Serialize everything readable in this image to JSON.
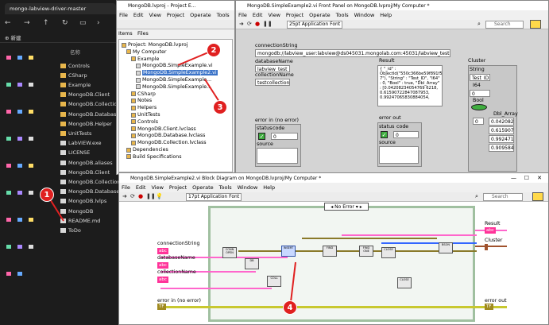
{
  "explorer": {
    "tab_title": "mongo-labview-driver-master",
    "new_label": "新建",
    "column_header": "名称",
    "items": [
      "Controls",
      "CSharp",
      "Example",
      "MongoDB.Client",
      "MongoDB.Collection",
      "MongoDB.Database",
      "MongoDB.Helper",
      "UnitTests",
      "LabVIEW.exe",
      "LICENSE",
      "MongoDB.aliases",
      "MongoDB.Client",
      "MongoDB.Collection",
      "MongoDB.Database",
      "MongoDB.lvlps",
      "MongoDB",
      "README.md",
      "ToDo"
    ]
  },
  "project": {
    "title": "MongoDB.lvproj - Project E...",
    "menu": [
      "File",
      "Edit",
      "View",
      "Project",
      "Operate",
      "Tools",
      "Window"
    ],
    "tabs": [
      "Items",
      "Files"
    ],
    "tree": [
      "Project: MongoDB.lvproj",
      "My Computer",
      "Example",
      "MongoDB.SimpleExample.vi",
      "MongoDB.SimpleExample2.vi",
      "MongoDB.SimpleExample...",
      "MongoDB.SimpleExample...",
      "CSharp",
      "Notes",
      "Helpers",
      "UnitTests",
      "Controls",
      "MongoDB.Client.lvclass",
      "MongoDB.Database.lvclass",
      "MongoDB.Collection.lvclass",
      "Dependencies",
      "Build Specifications"
    ]
  },
  "front": {
    "title": "MongoDB.SimpleExample2.vi Front Panel on MongoDB.lvproj/My Computer *",
    "menu": [
      "File",
      "Edit",
      "View",
      "Project",
      "Operate",
      "Tools",
      "Window",
      "Help"
    ],
    "font": "25pt Application Font",
    "search_placeholder": "Search",
    "connectionString_label": "connectionString",
    "connectionString_value": "mongodb://labview_user:labview@ds045031.mongolab.com:45031/labview_test",
    "databaseName_label": "databaseName",
    "databaseName_value": "labview_test",
    "collectionName_label": "collectionName",
    "collectionName_value": "testcollection1",
    "result_label": "Result",
    "result_value": "{ \"_id\" : ObjectId(\"550c366be59f891f54ed027 7\"), \"String\" : \"Test_ID\", \"I64\" : 0, \"Bool\" : true, \"Dbl_Array\" : [0.04208234054769 6218, 0.61590722847087953, 0.99247065830884054,",
    "cluster_label": "Cluster",
    "string_label": "String",
    "string_value": "Test_ID",
    "i64_label": "I64",
    "i64_value": "0",
    "bool_label": "Bool",
    "dbl_label": "Dbl_Array",
    "dbl_index": "0",
    "dbl_values": [
      "0.0420823",
      "0.615907",
      "0.992471",
      "0.909584"
    ],
    "error_in_label": "error in (no error)",
    "error_out_label": "error out",
    "status_label": "status",
    "code_label": "code",
    "code_value": "0",
    "source_label": "source"
  },
  "block": {
    "title": "MongoDB.SimpleExample2.vi Block Diagram on MongoDB.lvproj/My Computer *",
    "menu": [
      "File",
      "Edit",
      "View",
      "Project",
      "Operate",
      "Tools",
      "Window",
      "Help"
    ],
    "font": "17pt Application Font",
    "search_placeholder": "Search",
    "case_label": "No Error",
    "inputs": [
      "connectionString",
      "databaseName",
      "collectionName",
      "error in (no error)"
    ],
    "outputs": [
      "Result",
      "Cluster",
      "error out"
    ],
    "term_abc": "abc",
    "term_err": "TF",
    "nodes": [
      "CONN OPEN",
      "DB",
      "COLL",
      "INSERT",
      "FIND",
      "FIND ONE",
      "CLOSE",
      "CLOSE",
      "BSON"
    ]
  },
  "badges": [
    "1",
    "2",
    "3",
    "4"
  ]
}
